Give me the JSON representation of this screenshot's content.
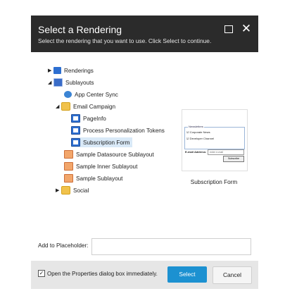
{
  "dialog": {
    "title": "Select a Rendering",
    "subtitle": "Select the rendering that you want to use. Click Select to continue."
  },
  "tree": {
    "items": [
      {
        "label": "Renderings",
        "icon": "renderings-icon"
      },
      {
        "label": "Sublayouts",
        "icon": "sublayouts-icon"
      },
      {
        "label": "App Center Sync",
        "icon": "globe-icon"
      },
      {
        "label": "Email Campaign",
        "icon": "folder-icon"
      },
      {
        "label": "PageInfo",
        "icon": "document-icon"
      },
      {
        "label": "Process Personalization Tokens",
        "icon": "document-icon"
      },
      {
        "label": "Subscription Form",
        "icon": "document-icon"
      },
      {
        "label": "Sample Datasource Sublayout",
        "icon": "sheet-icon"
      },
      {
        "label": "Sample Inner Sublayout",
        "icon": "sheet-icon"
      },
      {
        "label": "Sample Sublayout",
        "icon": "sheet-icon"
      },
      {
        "label": "Social",
        "icon": "folder-icon"
      }
    ]
  },
  "preview": {
    "caption": "Subscription Form",
    "legend": "Newsletters",
    "options": [
      "Corporate News",
      "Developer Channel"
    ],
    "email_label": "E-mail Address:",
    "email_placeholder": "enter e-mail",
    "button_label": "Subscribe"
  },
  "placeholder": {
    "label": "Add to Placeholder:",
    "value": ""
  },
  "footer": {
    "checkbox_label": "Open the Properties dialog box immediately.",
    "checkbox_checked": true,
    "select_label": "Select",
    "cancel_label": "Cancel"
  },
  "colors": {
    "header_bg": "#2b2b2b",
    "select_button": "#1c91d1",
    "footer_bg": "#e6e6e6",
    "selected_row": "#d9e9f7"
  }
}
